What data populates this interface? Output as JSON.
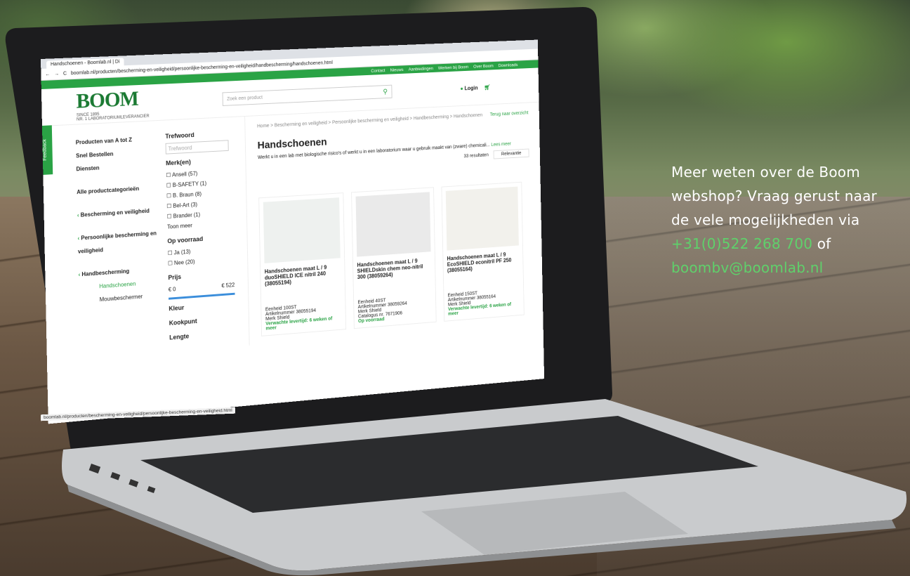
{
  "browser": {
    "tab_title": "Handschoenen - Boomlab.nl | Di",
    "url": "boomlab.nl/producten/bescherming-en-veiligheid/persoonlijke-bescherming-en-veiligheid/handbescherming/handschoenen.html",
    "status_url": "boomlab.nl/producten/bescherming-en-veiligheid/persoonlijke-bescherming-en-veiligheid.html"
  },
  "topnav": [
    "Contact",
    "Nieuws",
    "Aanbiedingen",
    "Werken bij Boom",
    "Over Boom",
    "Downloads"
  ],
  "header": {
    "logo": "BOOM",
    "logo_since": "SINCE 1895",
    "logo_tag": "NR. 1 LABORATORIUMLEVERANCIER",
    "search_placeholder": "Zoek een product",
    "login": "Login"
  },
  "leftnav": {
    "items": [
      "Producten van A tot Z",
      "Snel Bestellen",
      "Diensten"
    ],
    "all_categories": "Alle productcategorieën",
    "categories": [
      "Bescherming en veiligheid",
      "Persoonlijke bescherming en veiligheid",
      "Handbescherming"
    ],
    "active": "Handschoenen",
    "sub": "Mouwbeschermer"
  },
  "filters": {
    "trefwoord": "Trefwoord",
    "trefwoord_placeholder": "Trefwoord",
    "merk": "Merk(en)",
    "brands": [
      "Ansell (57)",
      "B-SAFETY (1)",
      "B. Braun (8)",
      "Bel-Art (3)",
      "Brander (1)"
    ],
    "toon_meer": "Toon meer",
    "voorraad": "Op voorraad",
    "voorraad_opts": [
      "Ja (13)",
      "Nee (20)"
    ],
    "prijs": "Prijs",
    "prijs_min": "€ 0",
    "prijs_max": "€ 522",
    "more": [
      "Kleur",
      "Kookpunt",
      "Lengte"
    ]
  },
  "main": {
    "breadcrumb": "Home > Bescherming en veiligheid > Persoonlijke bescherming en veiligheid > Handbescherming > Handschoenen",
    "back": "Terug naar overzicht",
    "title": "Handschoenen",
    "intro": "Werkt u in een lab met biologische risico's of werkt u in een laboratorium waar u gebruik maakt van (zware) chemicali...",
    "lees_meer": "Lees meer",
    "results": "33 resultaten",
    "sort": "Relevantie"
  },
  "products": [
    {
      "name": "Handschoenen maat L / 9 duoSHIELD ICE nitril 240 (38055194)",
      "eenheid": "100ST",
      "artikel": "38055194",
      "merk": "Shield",
      "status": "Verwachte levertijd: 6 weken of meer"
    },
    {
      "name": "Handschoenen maat L / 9 SHIELDskin chem neo-nitril 300 (38059264)",
      "eenheid": "40ST",
      "artikel": "38059264",
      "merk": "Shield",
      "catalogus": "7671906",
      "status": "Op voorraad"
    },
    {
      "name": "Handschoenen maat L / 9 EcoSHIELD econitril PF 250 (38055164)",
      "eenheid": "150ST",
      "artikel": "38055164",
      "merk": "Shield",
      "status": "Verwachte levertijd: 6 weken of meer"
    }
  ],
  "labels": {
    "eenheid": "Eenheid",
    "artikel": "Artikelnummer",
    "merk": "Merk",
    "catalogus": "Catalogus nr."
  },
  "feedback": "Feedback",
  "promo": {
    "line1": "Meer weten over de Boom webshop? Vraag gerust naar de vele mogelijkheden via",
    "phone": "+31(0)522 268 700",
    "of": "of",
    "email": "boombv@boomlab.nl"
  },
  "colors": {
    "accent": "#2aa345",
    "promo_green": "#5fd16b"
  }
}
